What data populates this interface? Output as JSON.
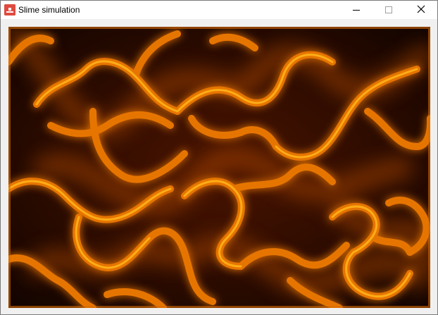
{
  "window": {
    "title": "Slime simulation",
    "icon": "app-icon",
    "controls": {
      "minimize": "minimize-icon",
      "maximize": "maximize-icon",
      "close": "close-icon"
    }
  },
  "canvas": {
    "description": "",
    "colors": {
      "background": "#1b0600",
      "glow_outer": "#8a3a00",
      "glow_mid": "#d96b00",
      "trail_core": "#ffb21a"
    }
  }
}
